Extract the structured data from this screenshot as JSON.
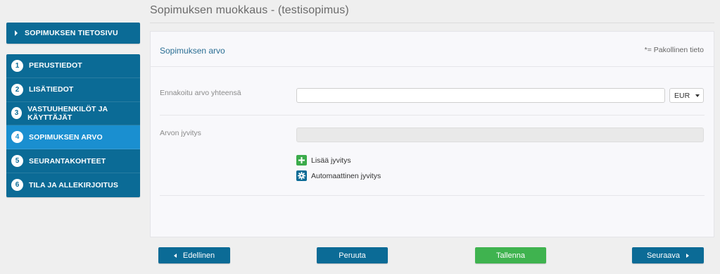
{
  "page": {
    "title": "Sopimuksen muokkaus - (testisopimus)"
  },
  "sidebar": {
    "top_link": "SOPIMUKSEN TIETOSIVU",
    "steps": [
      {
        "num": "1",
        "label": "PERUSTIEDOT",
        "active": false
      },
      {
        "num": "2",
        "label": "LISÄTIEDOT",
        "active": false
      },
      {
        "num": "3",
        "label": "VASTUUHENKILÖT JA KÄYTTÄJÄT",
        "active": false
      },
      {
        "num": "4",
        "label": "SOPIMUKSEN ARVO",
        "active": true
      },
      {
        "num": "5",
        "label": "SEURANTAKOHTEET",
        "active": false
      },
      {
        "num": "6",
        "label": "TILA JA ALLEKIRJOITUS",
        "active": false
      }
    ]
  },
  "panel": {
    "title": "Sopimuksen arvo",
    "required_note": "*= Pakollinen tieto",
    "estimated_value_label": "Ennakoitu arvo yhteensä",
    "estimated_value": "",
    "currency": "EUR",
    "allocation_label": "Arvon jyvitys",
    "add_allocation": "Lisää jyvitys",
    "auto_allocation": "Automaattinen jyvitys"
  },
  "footer": {
    "prev": "Edellinen",
    "cancel": "Peruuta",
    "save": "Tallenna",
    "next": "Seuraava"
  },
  "colors": {
    "primary": "#0b6b96",
    "active_step": "#1a8fd0",
    "save": "#3fb34f"
  }
}
